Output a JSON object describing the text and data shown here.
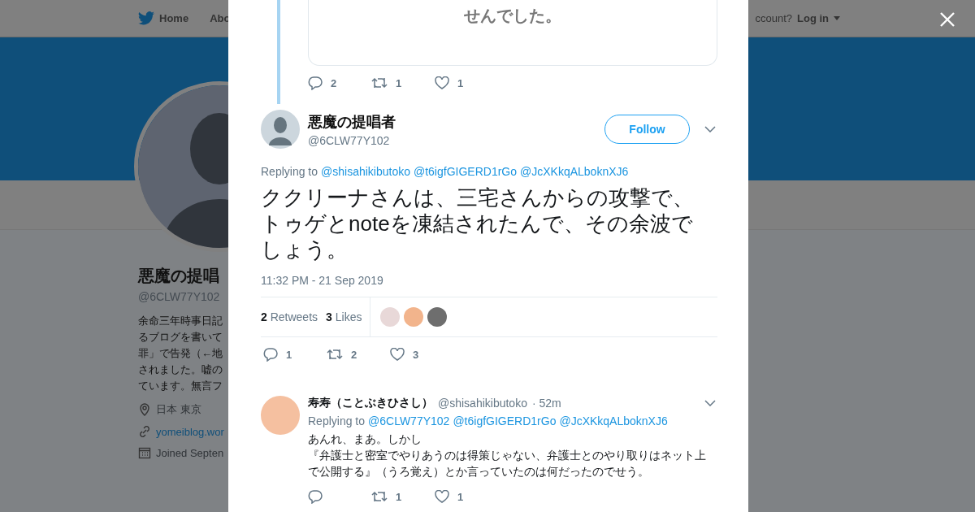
{
  "nav": {
    "home": "Home",
    "about": "Abo",
    "account_prompt": "ccount?",
    "login": "Log in"
  },
  "profile": {
    "name": "悪魔の提唱",
    "handle": "@6CLW77Y102",
    "bio": [
      "余命三年時事日記",
      "るブログを書いて",
      "罪」で告発（←地",
      "されました。嘘の",
      "ています。無言フ"
    ],
    "location": "日本 東京",
    "url": "yomeiblog.wor",
    "joined": "Joined Septen"
  },
  "modal": {
    "previous_tweet": {
      "card_text": "せんでした。",
      "actions": {
        "replies": "2",
        "retweets": "1",
        "likes": "1"
      }
    },
    "tweet": {
      "name": "悪魔の提唱者",
      "handle": "@6CLW77Y102",
      "follow": "Follow",
      "replying_label": "Replying to",
      "replying_to": [
        "@shisahikibutoko",
        "@t6igfGIGERD1rGo",
        "@JcXKkqALboknXJ6"
      ],
      "text": "ククリーナさんは、三宅さんからの攻撃で、トゥゲとnoteを凍結されたんで、その余波でしょう。",
      "time": "11:32 PM - 21 Sep 2019",
      "retweets_count": "2",
      "retweets_label": "Retweets",
      "likes_count": "3",
      "likes_label": "Likes",
      "likers": [
        {
          "color": "#e8d8d8"
        },
        {
          "color": "#f2b48c"
        },
        {
          "color": "#6e6e6e"
        }
      ],
      "actions": {
        "replies": "1",
        "retweets": "2",
        "likes": "3"
      }
    },
    "reply": {
      "name": "寿寿（ことぶきひさし）",
      "handle": "@shisahikibutoko",
      "time": "· 52m",
      "replying_label": "Replying to",
      "replying_to": [
        "@6CLW77Y102",
        "@t6igfGIGERD1rGo",
        "@JcXKkqALboknXJ6"
      ],
      "lines": [
        "あんれ、まあ。しかし",
        "『弁護士と密室でやりあうのは得策じゃない、弁護士とのやり取りはネット上で公開する』（うろ覚え）とか言っていたのは何だったのでせう。"
      ],
      "actions": {
        "retweets": "1",
        "likes": "1"
      }
    }
  }
}
